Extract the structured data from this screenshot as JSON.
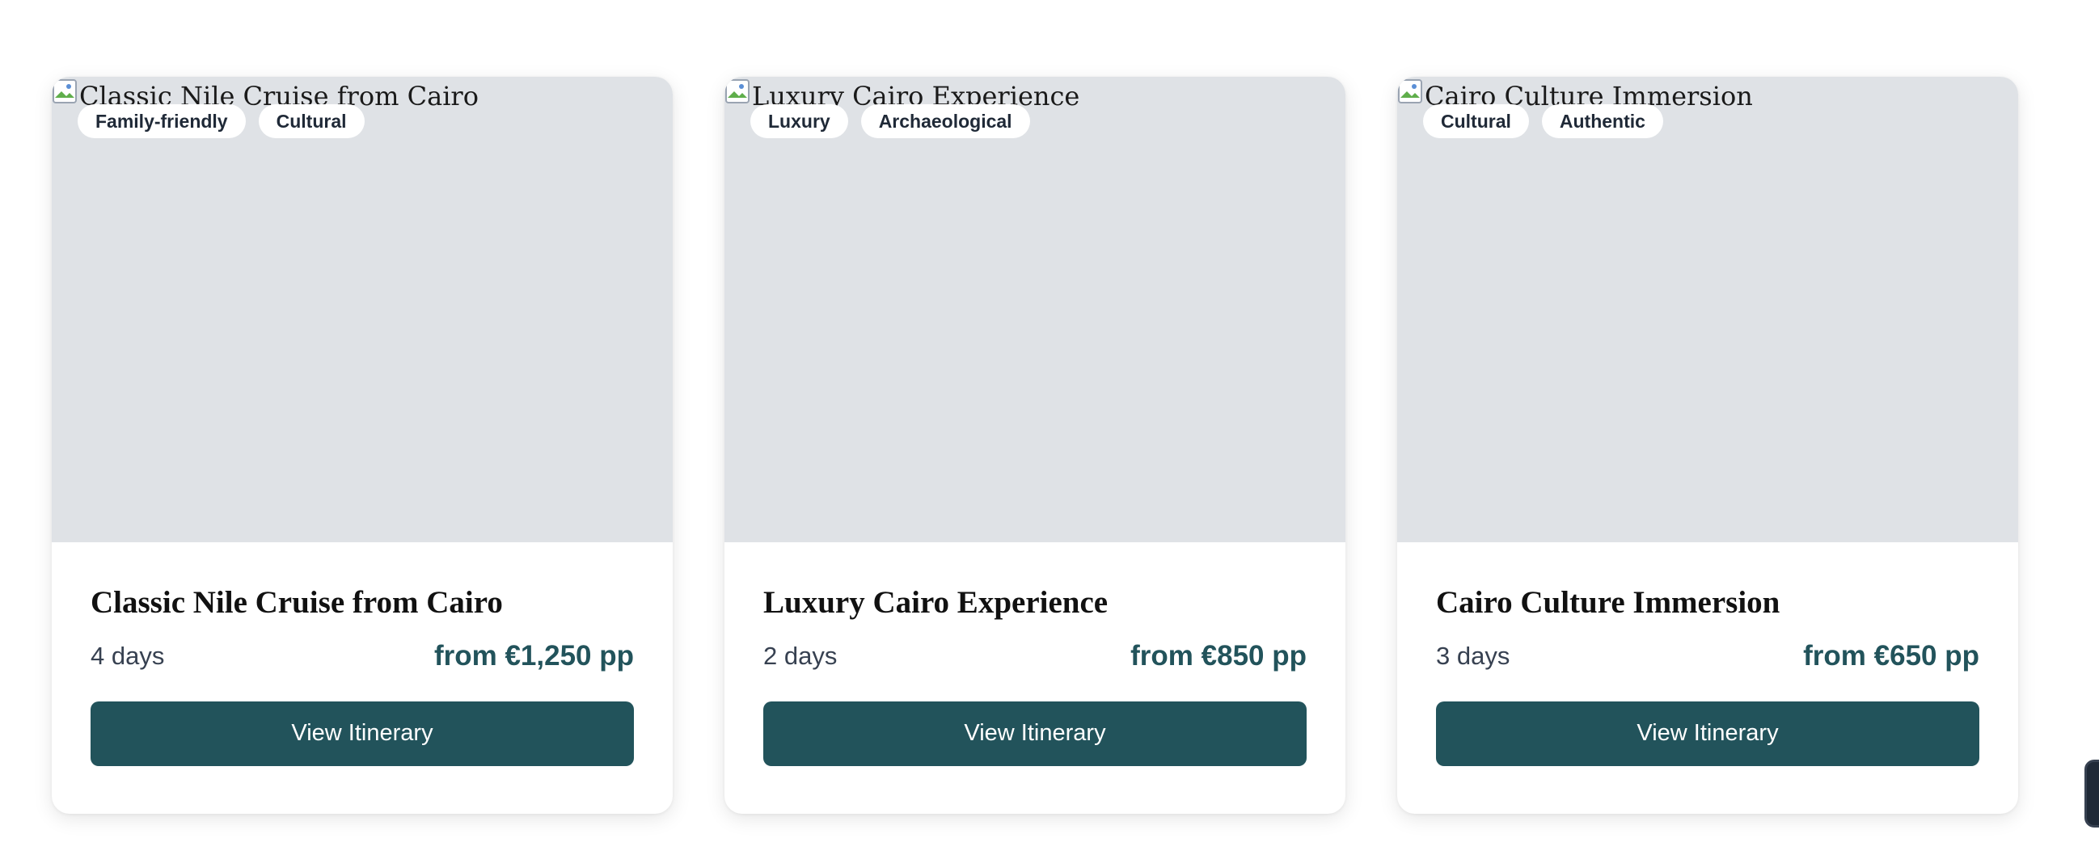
{
  "cards": [
    {
      "image_alt": "Classic Nile Cruise from Cairo",
      "tags": [
        "Family-friendly",
        "Cultural"
      ],
      "title": "Classic Nile Cruise from Cairo",
      "duration": "4 days",
      "price": "from €1,250 pp",
      "button_label": "View Itinerary"
    },
    {
      "image_alt": "Luxury Cairo Experience",
      "tags": [
        "Luxury",
        "Archaeological"
      ],
      "title": "Luxury Cairo Experience",
      "duration": "2 days",
      "price": "from €850 pp",
      "button_label": "View Itinerary"
    },
    {
      "image_alt": "Cairo Culture Immersion",
      "tags": [
        "Cultural",
        "Authentic"
      ],
      "title": "Cairo Culture Immersion",
      "duration": "3 days",
      "price": "from €650 pp",
      "button_label": "View Itinerary"
    }
  ],
  "colors": {
    "accent": "#22535b",
    "image_placeholder": "#dfe2e6",
    "card_bg": "#ffffff"
  },
  "icons": {
    "broken_image": "broken-image-icon"
  }
}
